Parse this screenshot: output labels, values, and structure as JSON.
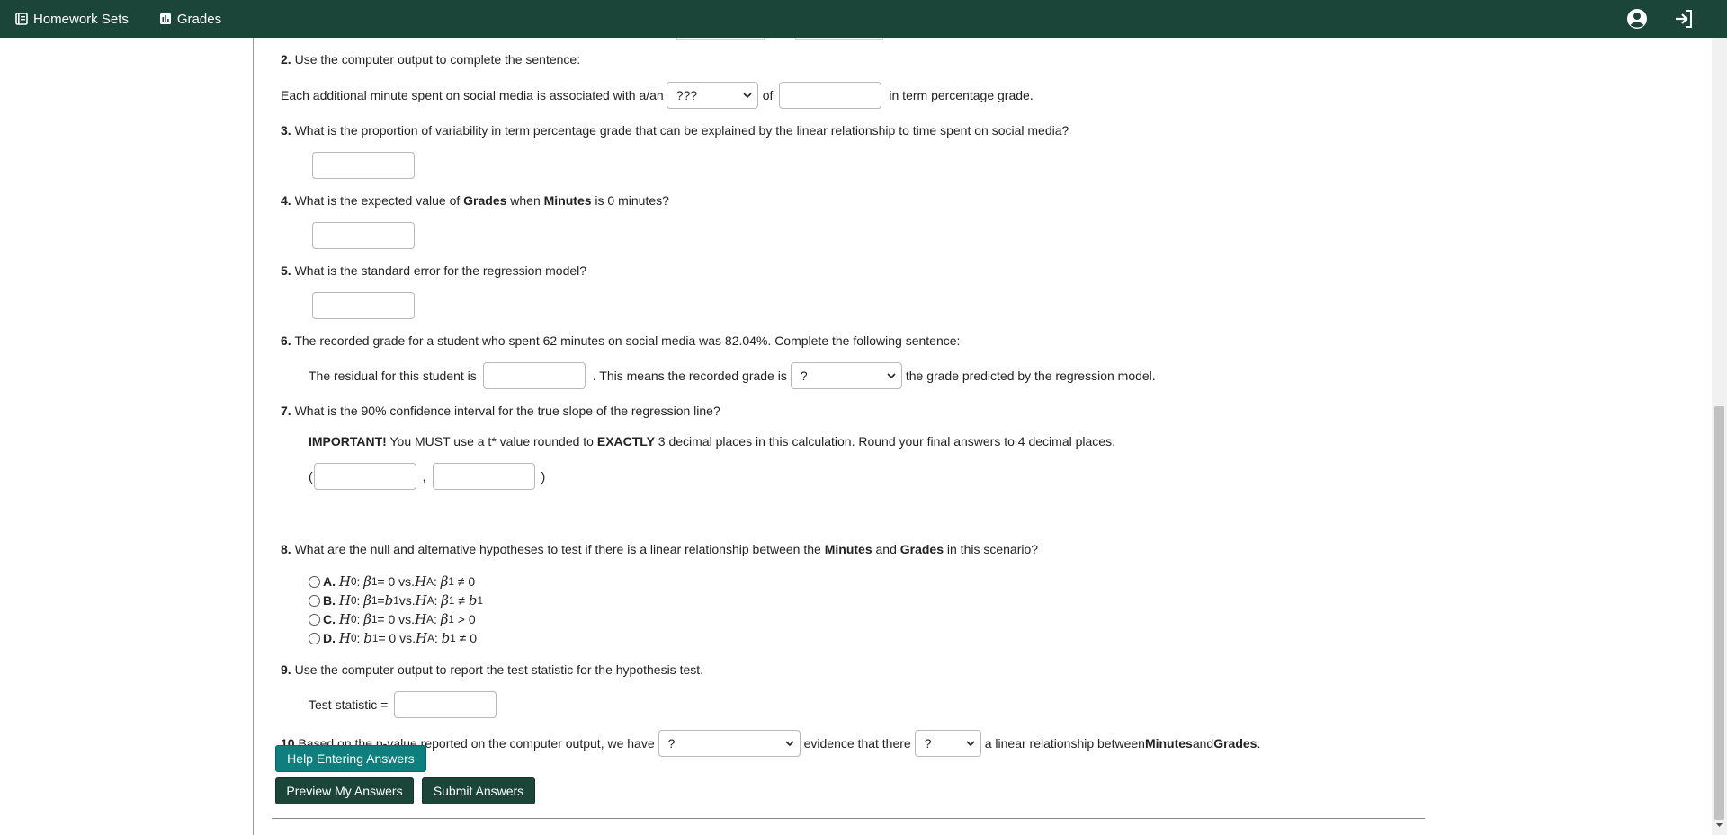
{
  "nav": {
    "homework_sets": "Homework Sets",
    "grades": "Grades",
    "icons": {
      "homework": "book-list-icon",
      "grades": "bar-chart-icon",
      "user": "user-circle-icon",
      "logout": "sign-out-icon"
    }
  },
  "colors": {
    "navbar": "#1a4538",
    "teal_button": "#0e7f7d",
    "dark_button": "#1a4538"
  },
  "q2": {
    "num": "2.",
    "text": " Use the computer output to complete the sentence:",
    "sentence_start": "Each additional minute spent on social media is associated with a/an",
    "select_value": "???",
    "of": "of",
    "sentence_end": "in term percentage grade.",
    "input_value": ""
  },
  "q3": {
    "num": "3.",
    "text": " What is the proportion of variability in term percentage grade that can be explained by the linear relationship to time spent on social media?",
    "input_value": ""
  },
  "q4": {
    "num": "4.",
    "t1": " What is the expected value of ",
    "b1": "Grades",
    "t2": " when ",
    "b2": "Minutes",
    "t3": " is 0 minutes?",
    "input_value": ""
  },
  "q5": {
    "num": "5.",
    "text": " What is the standard error for the regression model?",
    "input_value": ""
  },
  "q6": {
    "num": "6.",
    "text": " The recorded grade for a student who spent 62 minutes on social media was 82.04%. Complete the following sentence:",
    "s1": "The residual for this student is",
    "s2": ". This means the recorded grade is",
    "select_value": "?",
    "s3": "the grade predicted by the regression model.",
    "input_value": ""
  },
  "q7": {
    "num": "7.",
    "text": " What is the 90% confidence interval for the true slope of the regression line?",
    "important": "IMPORTANT!",
    "i1": " You MUST use a t* value rounded to ",
    "exactly": "EXACTLY",
    "i2": " 3 decimal places in this calculation. Round your final answers to 4 decimal places.",
    "open": "(",
    "comma": ",",
    "close": ")",
    "lower": "",
    "upper": ""
  },
  "q8": {
    "num": "8.",
    "t1": " What are the null and alternative hypotheses to test if there is a linear relationship between the ",
    "b1": "Minutes",
    "t2": " and ",
    "b2": "Grades",
    "t3": " in this scenario?",
    "options": [
      {
        "letter": "A",
        "h0_param": "β",
        "h0_sub": "1",
        "h0_rel": " = 0 vs. ",
        "ha_param": "β",
        "ha_sub": "1",
        "ha_rel": "≠",
        "ha_val": "0"
      },
      {
        "letter": "B",
        "h0_param": "β",
        "h0_sub": "1",
        "h0_rel": " = ",
        "h0_val_param": "b",
        "h0_val_sub": "1",
        "ha_param": "β",
        "ha_sub": "1",
        "ha_rel": "≠",
        "ha_val_param": "b",
        "ha_val_sub": "1"
      },
      {
        "letter": "C",
        "h0_param": "β",
        "h0_sub": "1",
        "h0_rel": " = 0 vs. ",
        "ha_param": "β",
        "ha_sub": "1",
        "ha_rel": ">",
        "ha_val": "0"
      },
      {
        "letter": "D",
        "h0_param": "b",
        "h0_sub": "1",
        "h0_rel": " = 0 vs. ",
        "ha_param": "b",
        "ha_sub": "1",
        "ha_rel": "≠",
        "ha_val": "0"
      }
    ],
    "h0_label": "H",
    "h0_label_sub": "0",
    "ha_label": "H",
    "ha_label_sub": "A",
    "vs": " vs. "
  },
  "q9": {
    "num": "9.",
    "text": " Use the computer output to report the test statistic for the hypothesis test.",
    "label": "Test statistic =",
    "input_value": ""
  },
  "q10": {
    "num": "10.",
    "t1": " Based on the p-value reported on the computer output, we have",
    "select1": "?",
    "t2": "evidence that there",
    "select2": "?",
    "t3": "a linear relationship between ",
    "b1": "Minutes",
    "t4": " and ",
    "b2": "Grades",
    "t5": "."
  },
  "buttons": {
    "help": "Help Entering Answers",
    "preview": "Preview My Answers",
    "submit": "Submit Answers"
  }
}
